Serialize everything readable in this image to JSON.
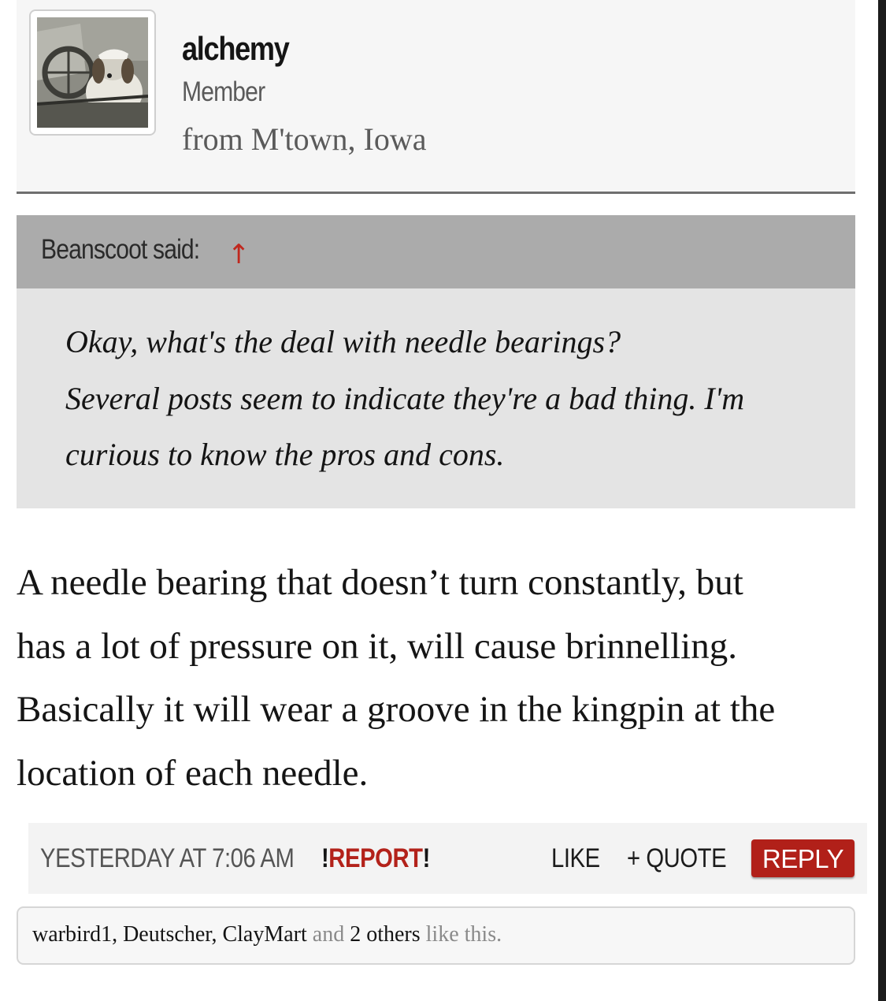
{
  "user": {
    "name": "alchemy",
    "role": "Member",
    "location": "from M'town, Iowa"
  },
  "quote": {
    "author_said": "Beanscoot said:",
    "arrow": "↑",
    "lines": [
      "Okay, what's the deal with needle bearings?",
      "Several posts seem to indicate they're a bad thing. I'm",
      "curious to know the pros and cons."
    ]
  },
  "post": {
    "lines": [
      "A needle bearing that doesn’t turn constantly, but",
      "has a lot of pressure on it, will cause brinnelling.",
      "Basically it will wear a groove in the kingpin at the",
      "location of each needle."
    ]
  },
  "actions": {
    "timestamp": "YESTERDAY AT 7:06 AM",
    "report_prefix": "!",
    "report_label": "REPORT",
    "report_suffix": "!",
    "like_label": "LIKE",
    "quote_label": "+ QUOTE",
    "reply_label": "REPLY"
  },
  "likes": {
    "users": [
      "warbird1",
      "Deutscher",
      "ClayMart"
    ],
    "sep1": ", ",
    "sep2": ", ",
    "and_text": " and ",
    "others": "2 others",
    "suffix": " like this."
  },
  "colors": {
    "accent_red": "#b12019",
    "quote_header_bg": "#ababab",
    "quote_body_bg": "#e4e4e4"
  }
}
